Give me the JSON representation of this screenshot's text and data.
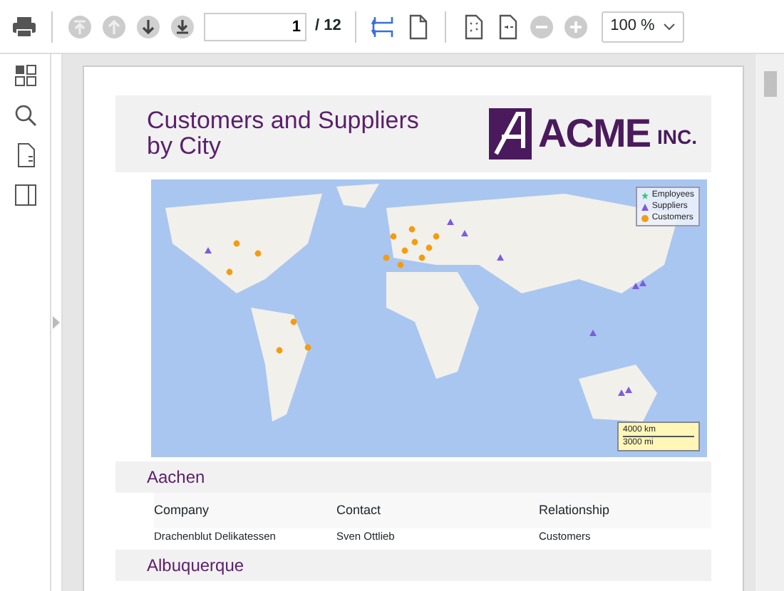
{
  "toolbar": {
    "buttons": [
      {
        "kind": "print",
        "disabled": false
      },
      {
        "kind": "first",
        "disabled": true
      },
      {
        "kind": "prev",
        "disabled": true
      },
      {
        "kind": "next",
        "disabled": false
      },
      {
        "kind": "last",
        "disabled": false
      }
    ],
    "page_input": {
      "value": "1"
    },
    "page_total": "/ 12",
    "view_buttons": [
      {
        "kind": "fit-width",
        "selected": true
      },
      {
        "kind": "page",
        "selected": false
      }
    ],
    "zoom_buttons": [
      {
        "kind": "zoom-page-in"
      },
      {
        "kind": "zoom-page-out"
      },
      {
        "kind": "minus"
      },
      {
        "kind": "plus"
      }
    ],
    "zoom_select": {
      "value": "100 %"
    }
  },
  "sidebar": {
    "items": [
      {
        "kind": "thumbnails"
      },
      {
        "kind": "search"
      },
      {
        "kind": "outline"
      },
      {
        "kind": "panel"
      }
    ]
  },
  "report": {
    "title": "Customers and Suppliers\nby City",
    "logo": {
      "main": "ACME",
      "suffix": "INC."
    },
    "map": {
      "legend": [
        {
          "label": "Employees",
          "color": "#2ecc71",
          "kind": "star"
        },
        {
          "label": "Suppliers",
          "color": "#7b5ce0",
          "kind": "triangle"
        },
        {
          "label": "Customers",
          "color": "#f39c12",
          "kind": "circle"
        }
      ],
      "scale": [
        "4000 km",
        "3000 mi"
      ]
    },
    "groups": [
      {
        "city": "Aachen",
        "columns": [
          "Company",
          "Contact",
          "Relationship"
        ],
        "rows": [
          [
            "Drachenblut Delikatessen",
            "Sven Ottlieb",
            "Customers"
          ]
        ]
      },
      {
        "city": "Albuquerque"
      }
    ]
  }
}
